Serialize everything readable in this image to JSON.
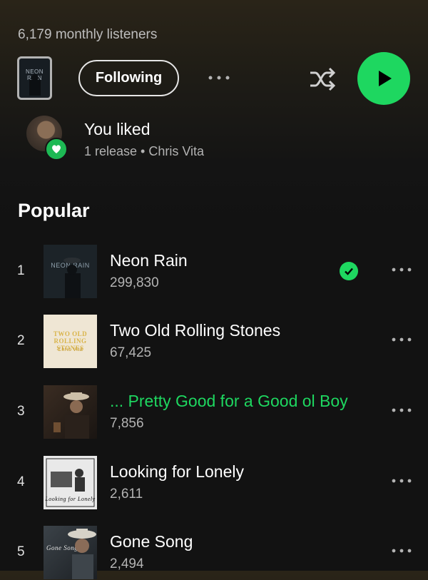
{
  "artist_header": {
    "monthly_listeners": "6,179 monthly listeners",
    "follow_button_label": "Following",
    "current_cover_text": "NEON RAIN"
  },
  "liked": {
    "title": "You liked",
    "subtitle": "1 release • Chris Vita"
  },
  "popular": {
    "heading": "Popular",
    "tracks": [
      {
        "rank": "1",
        "title": "Neon Rain",
        "plays": "299,830",
        "art_text": "NEON RAIN",
        "liked": true
      },
      {
        "rank": "2",
        "title": "Two Old Rolling Stones",
        "plays": "67,425",
        "art_text": "TWO OLD ROLLING STONES",
        "art_sub": "Chris Vita"
      },
      {
        "rank": "3",
        "title": "... Pretty Good for a Good ol Boy",
        "plays": "7,856",
        "playing": true
      },
      {
        "rank": "4",
        "title": "Looking for Lonely",
        "plays": "2,611",
        "art_text": "Looking for Lonely"
      },
      {
        "rank": "5",
        "title": "Gone Song",
        "plays": "2,494",
        "art_text": "Gone Song"
      }
    ]
  },
  "colors": {
    "accent": "#1ed760",
    "background": "#121212",
    "secondary_text": "#b3b3b3"
  },
  "icons": [
    "more-icon",
    "shuffle-icon",
    "play-icon",
    "heart-icon",
    "check-icon"
  ]
}
